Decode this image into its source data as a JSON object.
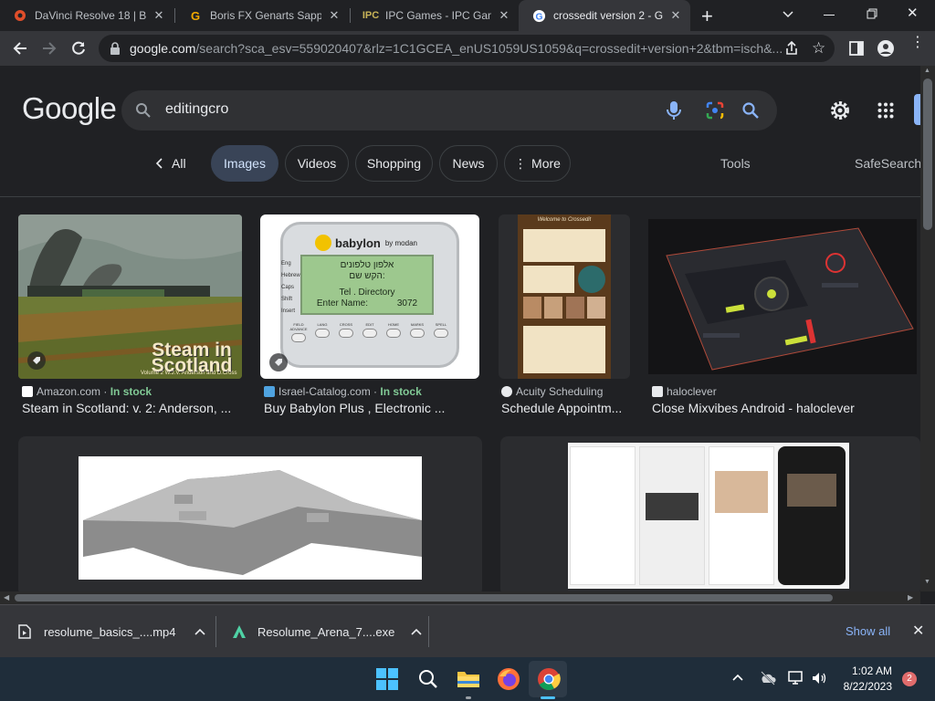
{
  "browser": {
    "tabs": [
      {
        "title": "DaVinci Resolve 18 | Bla",
        "favicon": "davinci-icon"
      },
      {
        "title": "Boris FX Genarts Sapph",
        "favicon": "genarts-g-icon"
      },
      {
        "title": "IPC Games - IPC Game",
        "favicon": "ipc-icon"
      },
      {
        "title": "crossedit version 2 - Go",
        "favicon": "google-icon"
      }
    ],
    "active_tab": 3,
    "url_host": "google.com",
    "url_path": "/search?sca_esv=559020407&rlz=1C1GCEA_enUS1059US1059&q=crossedit+version+2&tbm=isch&..."
  },
  "google": {
    "logo": "Google",
    "query": "editingcro",
    "chips": [
      "All",
      "Images",
      "Videos",
      "Shopping",
      "News",
      "More"
    ],
    "tools": "Tools",
    "safesearch": "SafeSearch"
  },
  "results": [
    {
      "source": "Amazon.com",
      "stock": "In stock",
      "title": "Steam in Scotland: v. 2: Anderson, ...",
      "img_title": "Steam in Scotland",
      "img_credit": "Volume 2  W.J.V. Anderson and D.Cross"
    },
    {
      "source": "Israel-Catalog.com",
      "stock": "In stock",
      "title": "Buy Babylon Plus , Electronic ...",
      "brand": "babylon",
      "brand_sub": "by modan",
      "lcd_line1": "אלפון טלפונים",
      "lcd_line2": "הקש שם:",
      "lcd_line3": "Tel . Directory",
      "lcd_line4": "Enter Name:",
      "lcd_num": "3072",
      "keys_left": [
        "Eng",
        "Hebrew",
        "Caps",
        "Shift",
        "Insert"
      ],
      "buttons": [
        "FIELD ADVANCE",
        "LANG",
        "CROSS",
        "EDIT",
        "HOME",
        "MARKS",
        "SPELL"
      ]
    },
    {
      "source": "Acuity Scheduling",
      "stock": "",
      "title": "Schedule Appointm...",
      "poster_title": "Welcome to Crossedit"
    },
    {
      "source": "haloclever",
      "stock": "",
      "title": "Close Mixvibes Android - haloclever"
    }
  ],
  "downloads": [
    {
      "name": "resolume_basics_....mp4"
    },
    {
      "name": "Resolume_Arena_7....exe"
    }
  ],
  "show_all": "Show all",
  "clock": {
    "time": "1:02 AM",
    "date": "8/22/2023"
  },
  "notifications": "2"
}
